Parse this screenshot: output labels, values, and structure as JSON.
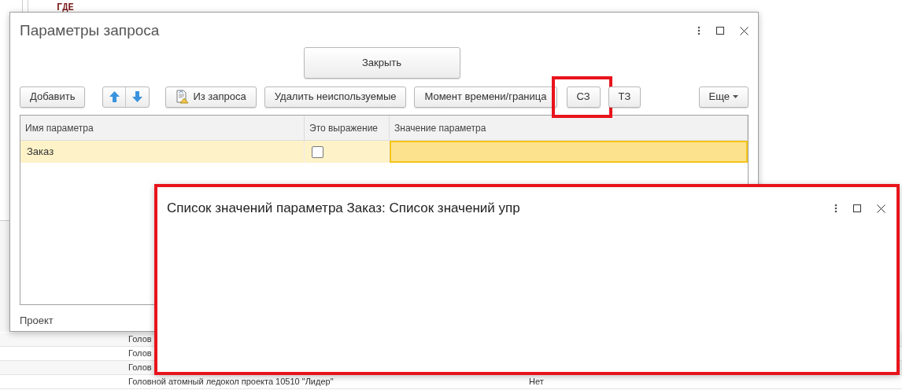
{
  "editor": {
    "line": "ГДЕ"
  },
  "background_table": {
    "rows": [
      {
        "column_1": "Голов"
      },
      {
        "column_1": "Голов"
      },
      {
        "column_1": "Голов"
      },
      {
        "column_1": "Головной атомный ледокол проекта 10510 \"Лидер\"",
        "column_2": "Нет"
      }
    ]
  },
  "dialog": {
    "title": "Параметры запроса",
    "close_button": "Закрыть",
    "toolbar": [
      {
        "kind": "button",
        "label": "Добавить"
      },
      {
        "kind": "arrows"
      },
      {
        "kind": "icon-button",
        "label": "Из запроса"
      },
      {
        "kind": "button",
        "label": "Удалить неиспользуемые"
      },
      {
        "kind": "button",
        "label": "Момент времени/граница"
      },
      {
        "kind": "button",
        "label": "СЗ",
        "highlighted": true
      },
      {
        "kind": "button",
        "label": "ТЗ",
        "highlighted": false
      },
      {
        "kind": "menu",
        "label": "Еще"
      }
    ],
    "table": {
      "columns": [
        "Имя параметра",
        "Это выражение",
        "Значение параметра"
      ],
      "rows": [
        {
          "name": "Заказ",
          "expression": false,
          "selected": true
        }
      ]
    },
    "footer": "Проект"
  },
  "value_list_window": {
    "title": "Список значений параметра Заказ: Список значений упр",
    "highlighted": true
  }
}
